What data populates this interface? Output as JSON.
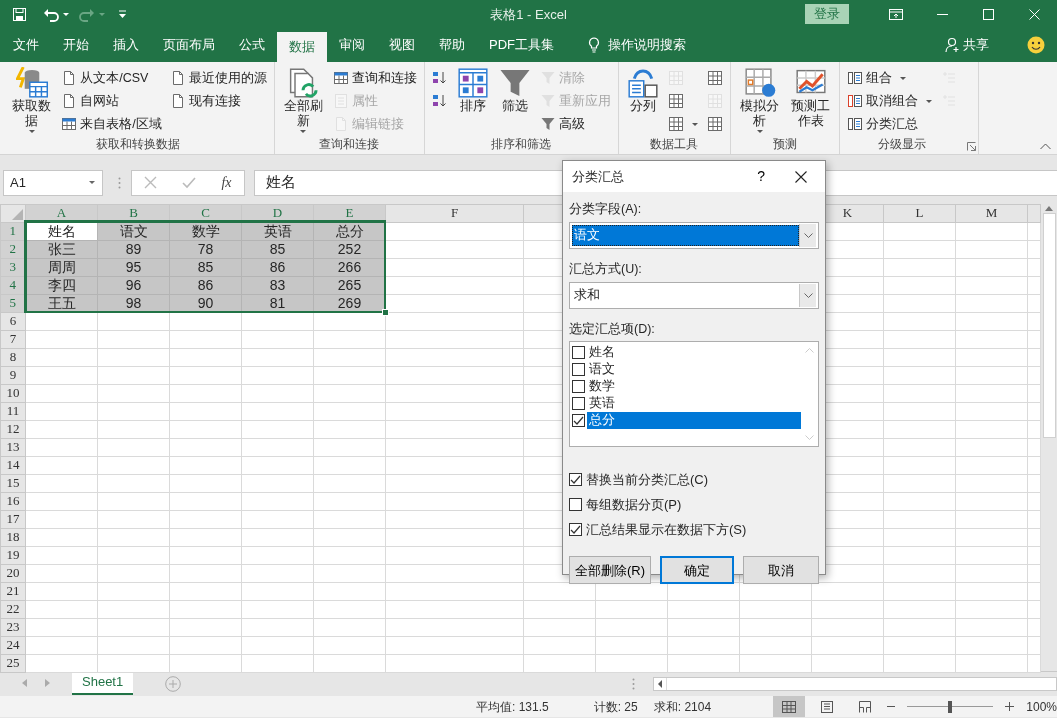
{
  "window": {
    "title": "表格1 - Excel",
    "sign_in": "登录"
  },
  "ribbon_tabs": [
    {
      "label": "文件",
      "selected": false
    },
    {
      "label": "开始",
      "selected": false
    },
    {
      "label": "插入",
      "selected": false
    },
    {
      "label": "页面布局",
      "selected": false
    },
    {
      "label": "公式",
      "selected": false
    },
    {
      "label": "数据",
      "selected": true
    },
    {
      "label": "审阅",
      "selected": false
    },
    {
      "label": "视图",
      "selected": false
    },
    {
      "label": "帮助",
      "selected": false
    },
    {
      "label": "PDF工具集",
      "selected": false
    }
  ],
  "tell_me": "操作说明搜索",
  "share": "共享",
  "ribbon_groups": [
    {
      "label": "获取和转换数据",
      "launcher": false,
      "columns": [
        {
          "kind": "large",
          "label": "获取数据",
          "dropdown": true,
          "disabled": false
        },
        {
          "kind": "stack",
          "items": [
            {
              "label": "从文本/CSV",
              "dropdown": false,
              "disabled": false
            },
            {
              "label": "自网站",
              "dropdown": false,
              "disabled": false
            },
            {
              "label": "来自表格/区域",
              "dropdown": false,
              "disabled": false
            }
          ]
        },
        {
          "kind": "stack",
          "items": [
            {
              "label": "最近使用的源",
              "dropdown": false,
              "disabled": false
            },
            {
              "label": "现有连接",
              "dropdown": false,
              "disabled": false
            }
          ]
        }
      ]
    },
    {
      "label": "查询和连接",
      "launcher": false,
      "columns": [
        {
          "kind": "large",
          "label": "全部刷新",
          "dropdown": true,
          "disabled": false
        },
        {
          "kind": "stack",
          "items": [
            {
              "label": "查询和连接",
              "dropdown": false,
              "disabled": false
            },
            {
              "label": "属性",
              "dropdown": false,
              "disabled": true
            },
            {
              "label": "编辑链接",
              "dropdown": false,
              "disabled": true
            }
          ]
        }
      ]
    },
    {
      "label": "排序和筛选",
      "launcher": false,
      "columns": [
        {
          "kind": "stack",
          "items": [
            {
              "dropdown": false,
              "disabled": false
            },
            {
              "dropdown": false,
              "disabled": false
            }
          ]
        },
        {
          "kind": "large",
          "label": "排序",
          "dropdown": false,
          "disabled": false
        },
        {
          "kind": "large",
          "label": "筛选",
          "dropdown": false,
          "disabled": false
        },
        {
          "kind": "stack",
          "items": [
            {
              "label": "清除",
              "dropdown": false,
              "disabled": true
            },
            {
              "label": "重新应用",
              "dropdown": false,
              "disabled": true
            },
            {
              "label": "高级",
              "dropdown": false,
              "disabled": false
            }
          ]
        }
      ]
    },
    {
      "label": "数据工具",
      "launcher": false,
      "columns": [
        {
          "kind": "large",
          "label": "分列",
          "dropdown": false,
          "disabled": false
        },
        {
          "kind": "stack",
          "items": [
            {
              "dropdown": false,
              "disabled": true
            },
            {
              "dropdown": false,
              "disabled": false
            },
            {
              "dropdown": true,
              "disabled": false
            }
          ]
        },
        {
          "kind": "stack",
          "items": [
            {
              "dropdown": false,
              "disabled": false
            },
            {
              "dropdown": false,
              "disabled": true
            },
            {
              "dropdown": false,
              "disabled": false
            }
          ]
        }
      ]
    },
    {
      "label": "预测",
      "launcher": false,
      "columns": [
        {
          "kind": "large",
          "label": "模拟分析",
          "dropdown": true,
          "disabled": false
        },
        {
          "kind": "large",
          "label": "预测工作表",
          "dropdown": false,
          "disabled": false
        }
      ]
    },
    {
      "label": "分级显示",
      "launcher": true,
      "columns": [
        {
          "kind": "stack",
          "items": [
            {
              "label": "组合",
              "dropdown": true,
              "disabled": false
            },
            {
              "label": "取消组合",
              "dropdown": true,
              "disabled": false
            },
            {
              "label": "分类汇总",
              "dropdown": false,
              "disabled": false
            }
          ]
        },
        {
          "kind": "stack",
          "items": [
            {
              "dropdown": false,
              "disabled": true
            },
            {
              "dropdown": false,
              "disabled": true
            }
          ]
        }
      ]
    }
  ],
  "formula_bar": {
    "name_box": "A1",
    "fx": "fx",
    "formula": "姓名"
  },
  "sheet": {
    "columns": [
      {
        "label": "A",
        "selected": true
      },
      {
        "label": "B",
        "selected": true
      },
      {
        "label": "C",
        "selected": true
      },
      {
        "label": "D",
        "selected": true
      },
      {
        "label": "E",
        "selected": true
      },
      {
        "label": "F",
        "selected": false
      }
    ],
    "columns_after_dialog": [
      {
        "label": "K",
        "selected": false
      },
      {
        "label": "L",
        "selected": false
      },
      {
        "label": "M",
        "selected": false
      }
    ],
    "rows": [
      {
        "header": "1",
        "selected": true,
        "cells": [
          "姓名",
          "语文",
          "数学",
          "英语",
          "总分"
        ]
      },
      {
        "header": "2",
        "selected": true,
        "cells": [
          "张三",
          "89",
          "78",
          "85",
          "252"
        ]
      },
      {
        "header": "3",
        "selected": true,
        "cells": [
          "周周",
          "95",
          "85",
          "86",
          "266"
        ]
      },
      {
        "header": "4",
        "selected": true,
        "cells": [
          "李四",
          "96",
          "86",
          "83",
          "265"
        ]
      },
      {
        "header": "5",
        "selected": true,
        "cells": [
          "王五",
          "98",
          "90",
          "81",
          "269"
        ]
      },
      {
        "header": "6",
        "selected": false
      },
      {
        "header": "7",
        "selected": false
      },
      {
        "header": "8",
        "selected": false
      },
      {
        "header": "9",
        "selected": false
      },
      {
        "header": "10",
        "selected": false
      },
      {
        "header": "11",
        "selected": false
      },
      {
        "header": "12",
        "selected": false
      },
      {
        "header": "13",
        "selected": false
      },
      {
        "header": "14",
        "selected": false
      },
      {
        "header": "15",
        "selected": false
      },
      {
        "header": "16",
        "selected": false
      },
      {
        "header": "17",
        "selected": false
      },
      {
        "header": "18",
        "selected": false
      },
      {
        "header": "19",
        "selected": false
      },
      {
        "header": "20",
        "selected": false
      },
      {
        "header": "21",
        "selected": false
      },
      {
        "header": "22",
        "selected": false
      },
      {
        "header": "23",
        "selected": false
      },
      {
        "header": "24",
        "selected": false
      },
      {
        "header": "25",
        "selected": false
      }
    ]
  },
  "sheet_tabs": [
    {
      "label": "Sheet1",
      "selected": true
    }
  ],
  "status_bar": {
    "stats": [
      "平均值: 131.5",
      "计数: 25",
      "求和: 2104"
    ],
    "views": [
      {
        "selected": true
      },
      {
        "selected": false
      },
      {
        "selected": false
      }
    ],
    "zoom_slider": {
      "level": 0.5
    },
    "zoom": "100%"
  },
  "dialog": {
    "title": "分类汇总",
    "help": "?",
    "group_by": {
      "label": "分类字段(A):",
      "value": "语文",
      "focused": true
    },
    "function": {
      "label": "汇总方式(U):",
      "value": "求和",
      "focused": false
    },
    "subtotal_label": "选定汇总项(D):",
    "subtotal_items": [
      {
        "label": "姓名",
        "checked": false,
        "selected": false
      },
      {
        "label": "语文",
        "checked": false,
        "selected": false
      },
      {
        "label": "数学",
        "checked": false,
        "selected": false
      },
      {
        "label": "英语",
        "checked": false,
        "selected": false
      },
      {
        "label": "总分",
        "checked": true,
        "selected": true
      }
    ],
    "options": [
      {
        "label": "替换当前分类汇总(C)",
        "checked": true
      },
      {
        "label": "每组数据分页(P)",
        "checked": false
      },
      {
        "label": "汇总结果显示在数据下方(S)",
        "checked": true
      }
    ],
    "buttons": [
      {
        "label": "全部删除(R)",
        "default": false
      },
      {
        "label": "确定",
        "default": true
      },
      {
        "label": "取消",
        "default": false
      }
    ]
  }
}
